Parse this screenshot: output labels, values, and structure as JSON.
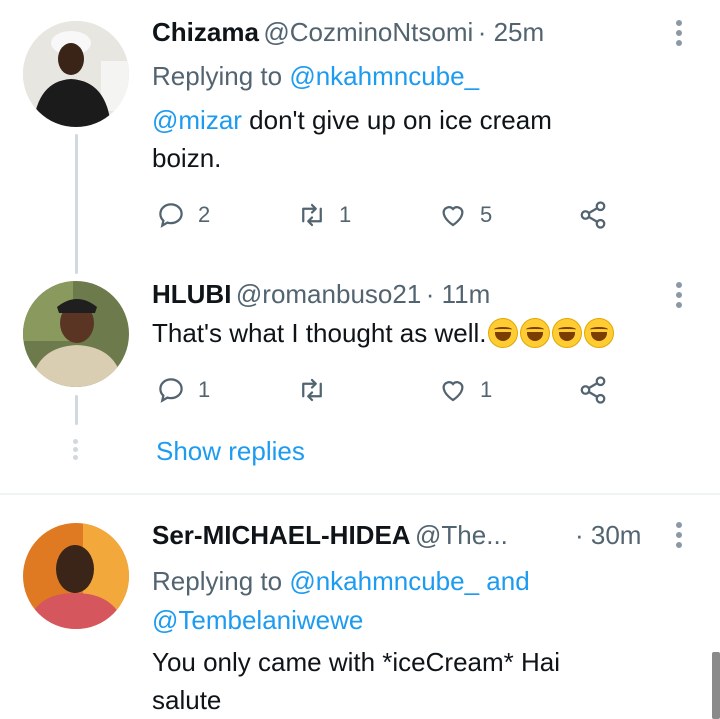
{
  "tweets": [
    {
      "name": "Chizama",
      "handle": "@CozminoNtsomi",
      "time": "· 25m",
      "replying_prefix": "Replying to ",
      "replying_to": "@nkahmncube_",
      "mention": "@mizar",
      "text_line1": " don't give up on ice cream",
      "text_line2": "boizn.",
      "replies": "2",
      "retweets": "1",
      "likes": "5"
    },
    {
      "name": "HLUBI",
      "handle": "@romanbuso21",
      "time": "· 11m",
      "text": "That's what I thought as well.",
      "emoji_count": 4,
      "replies": "1",
      "retweets": "",
      "likes": "1"
    },
    {
      "name": "Ser-MICHAEL-HIDEA",
      "handle": "@The...",
      "time": "· 30m",
      "replying_prefix": "Replying to ",
      "replying_to": "@nkahmncube_",
      "replying_and": " and",
      "replying_to_2": "@Tembelaniwewe",
      "text_line1": "You only came with *iceCream* Hai",
      "text_line2": "salute"
    }
  ],
  "show_replies": "Show replies",
  "colors": {
    "link": "#1d9bf0",
    "secondary": "#536471",
    "text": "#0f1419"
  },
  "icons": [
    "reply-icon",
    "retweet-icon",
    "like-icon",
    "share-icon",
    "more-icon"
  ]
}
